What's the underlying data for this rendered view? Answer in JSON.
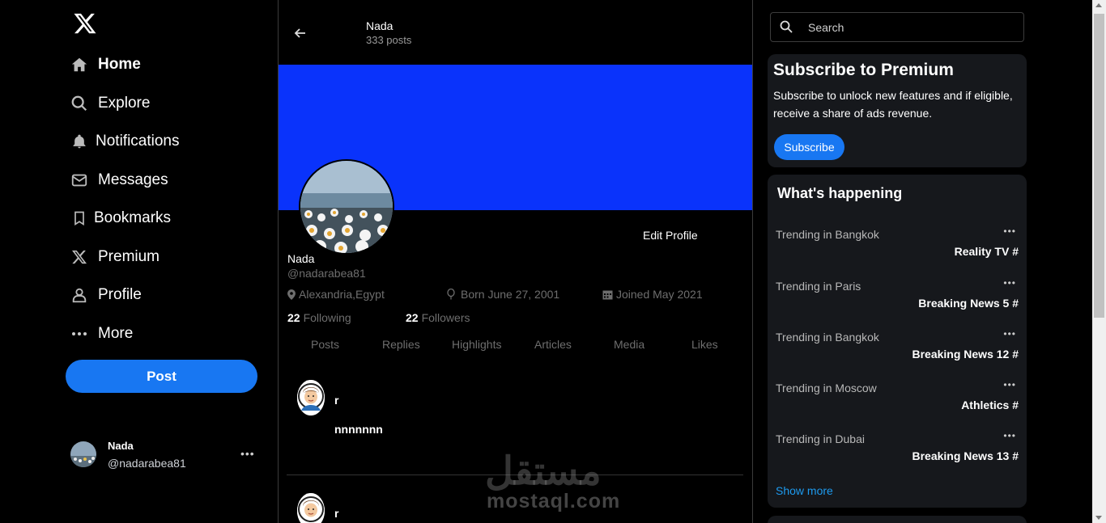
{
  "nav": {
    "items": [
      {
        "label": "Home",
        "icon": "home-icon"
      },
      {
        "label": "Explore",
        "icon": "search-icon"
      },
      {
        "label": "Notifications",
        "icon": "bell-icon"
      },
      {
        "label": "Messages",
        "icon": "envelope-icon"
      },
      {
        "label": "Bookmarks",
        "icon": "bookmark-icon"
      },
      {
        "label": "Premium",
        "icon": "x-icon"
      },
      {
        "label": "Profile",
        "icon": "person-icon"
      },
      {
        "label": "More",
        "icon": "more-icon"
      }
    ],
    "post_label": "Post"
  },
  "account": {
    "name": "Nada",
    "handle": "@nadarabea81"
  },
  "header": {
    "name": "Nada",
    "posts": "333 posts"
  },
  "profile": {
    "edit_label": "Edit Profile",
    "name": "Nada",
    "handle": "@nadarabea81",
    "location": "Alexandria,Egypt",
    "born": "Born June 27, 2001",
    "joined": "Joined May 2021",
    "following_count": "22",
    "following_label": "Following",
    "followers_count": "22",
    "followers_label": "Followers"
  },
  "tabs": [
    "Posts",
    "Replies",
    "Highlights",
    "Articles",
    "Media",
    "Likes"
  ],
  "tweets": [
    {
      "user": "r",
      "text": "nnnnnnn"
    },
    {
      "user": "r",
      "text": ""
    }
  ],
  "watermark": {
    "arabic": "مستقل",
    "latin": "mostaql.com"
  },
  "search": {
    "placeholder": "Search"
  },
  "premium": {
    "title": "Subscribe to Premium",
    "text": "Subscribe to unlock new features and if eligible, receive a share of ads revenue.",
    "button": "Subscribe"
  },
  "happening": {
    "title": "What's happening",
    "trends": [
      {
        "location": "Trending in Bangkok",
        "topic": "Reality TV #"
      },
      {
        "location": "Trending in Paris",
        "topic": "Breaking News 5 #"
      },
      {
        "location": "Trending in Bangkok",
        "topic": "Breaking News 12 #"
      },
      {
        "location": "Trending in Moscow",
        "topic": "Athletics #"
      },
      {
        "location": "Trending in Dubai",
        "topic": "Breaking News 13 #"
      }
    ],
    "show_more": "Show more"
  },
  "colors": {
    "accent": "#1877f2",
    "banner": "#0a33fb",
    "link": "#1d9bf0"
  }
}
